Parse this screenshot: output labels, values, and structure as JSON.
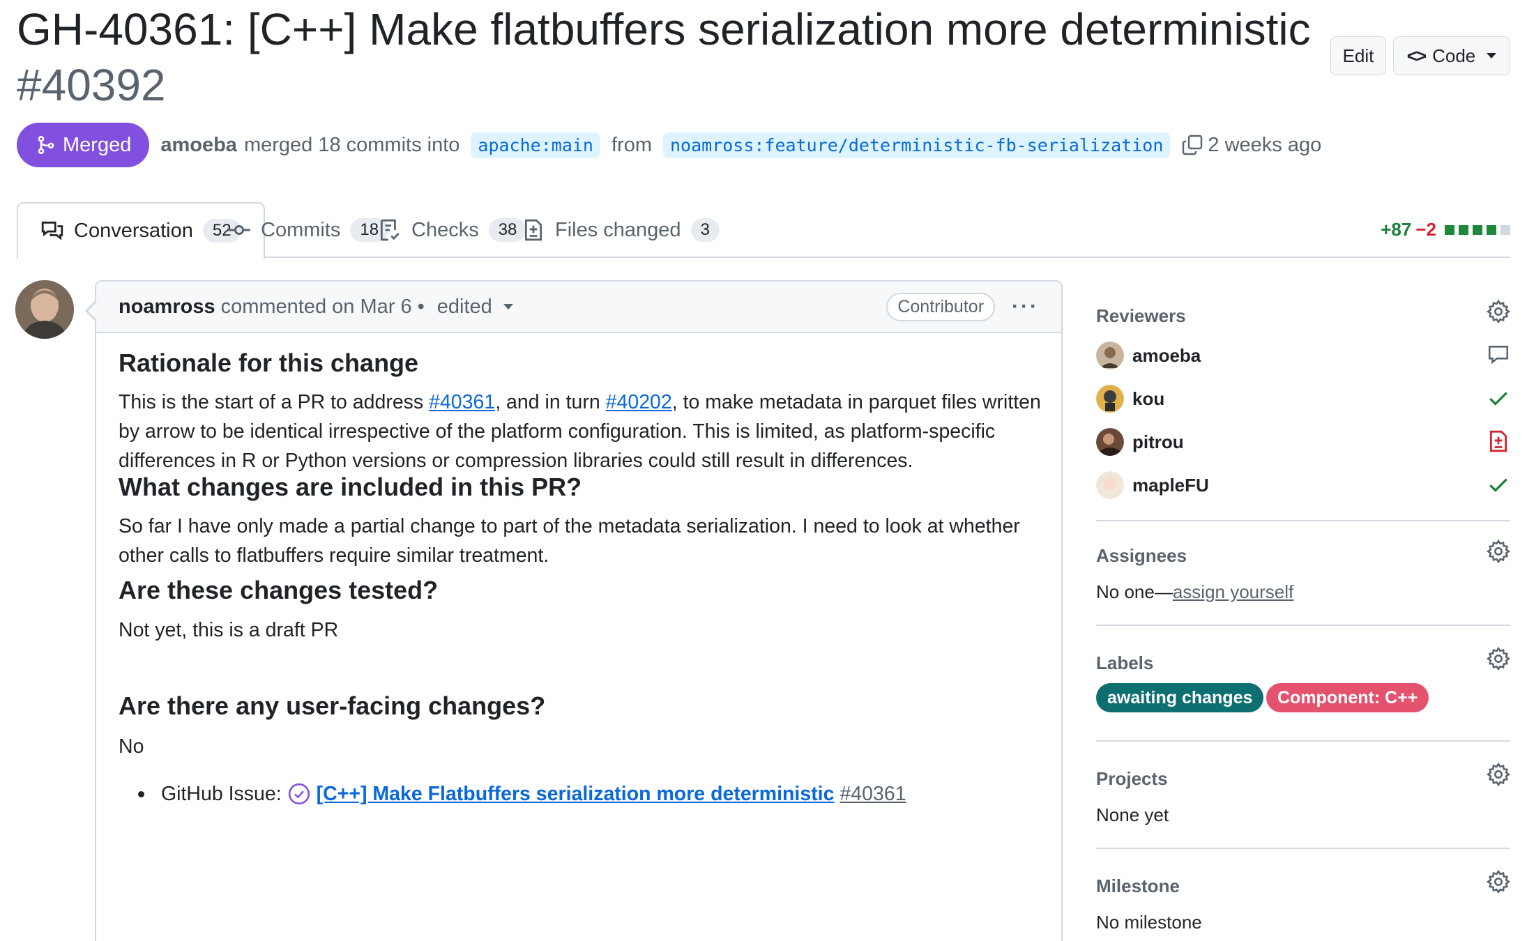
{
  "header": {
    "title": "GH-40361: [C++] Make flatbuffers serialization more deterministic",
    "number": "#40392",
    "edit_label": "Edit",
    "code_label": "Code"
  },
  "meta": {
    "state": "Merged",
    "merger": "amoeba",
    "merged_text": "merged 18 commits into",
    "base_branch": "apache:main",
    "from_text": "from",
    "head_branch": "noamross:feature/deterministic-fb-serialization",
    "time_ago": "2 weeks ago"
  },
  "tabs": [
    {
      "label": "Conversation",
      "count": "52",
      "icon": "comment-discussion-icon"
    },
    {
      "label": "Commits",
      "count": "18",
      "icon": "git-commit-icon"
    },
    {
      "label": "Checks",
      "count": "38",
      "icon": "checklist-icon"
    },
    {
      "label": "Files changed",
      "count": "3",
      "icon": "file-diff-icon"
    }
  ],
  "diffstat": {
    "additions": "+87",
    "deletions": "−2"
  },
  "comment": {
    "author": "noamross",
    "action": "commented on Mar 6",
    "separator": "•",
    "edited": "edited",
    "role": "Contributor",
    "more": "···",
    "sections": {
      "h1": "Rationale for this change",
      "p1_a": "This is the start of a PR to address ",
      "p1_link1": "#40361",
      "p1_b": ", and in turn ",
      "p1_link2": "#40202",
      "p1_c": ", to make metadata in parquet files written by arrow to be identical irrespective of the platform configuration. This is limited, as platform-specific differences in R or Python versions or compression libraries could still result in differences.",
      "h2": "What changes are included in this PR?",
      "p2": "So far I have only made a partial change to part of the metadata serialization. I need to look at whether other calls to flatbuffers require similar treatment.",
      "h3": "Are these changes tested?",
      "p3": "Not yet, this is a draft PR",
      "h4": "Are there any user-facing changes?",
      "p4": "No",
      "bullet_prefix": "GitHub Issue:",
      "bullet_link": "[C++] Make Flatbuffers serialization more deterministic",
      "bullet_num": "#40361"
    }
  },
  "sidebar": {
    "reviewers": {
      "title": "Reviewers",
      "items": [
        {
          "name": "amoeba",
          "status": "commented",
          "status_icon": "comment-icon"
        },
        {
          "name": "kou",
          "status": "approved",
          "status_icon": "check-icon"
        },
        {
          "name": "pitrou",
          "status": "changes-requested",
          "status_icon": "file-diff-icon"
        },
        {
          "name": "mapleFU",
          "status": "approved",
          "status_icon": "check-icon"
        }
      ]
    },
    "assignees": {
      "title": "Assignees",
      "text": "No one—",
      "link": "assign yourself"
    },
    "labels": {
      "title": "Labels",
      "items": [
        {
          "name": "awaiting changes",
          "color": "#0e6f71"
        },
        {
          "name": "Component: C++",
          "color": "#e4526e"
        }
      ]
    },
    "projects": {
      "title": "Projects",
      "text": "None yet"
    },
    "milestone": {
      "title": "Milestone",
      "text": "No milestone"
    }
  },
  "colors": {
    "merged": "#8250df",
    "link": "#0969da",
    "added": "#1a7f37",
    "deleted": "#d1242f",
    "border": "#d1d9e0"
  }
}
